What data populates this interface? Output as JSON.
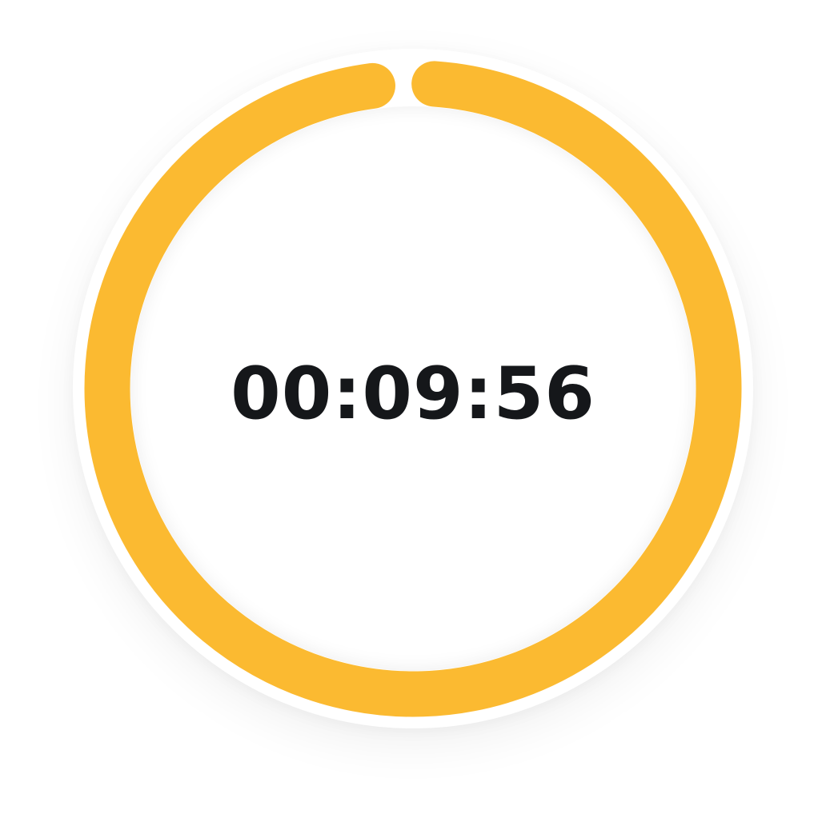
{
  "timer": {
    "display_time": "00:09:56",
    "progress_fraction": 0.99,
    "ring_color": "#FBBA31",
    "text_color": "#15171A",
    "face_color": "#FFFFFF"
  }
}
